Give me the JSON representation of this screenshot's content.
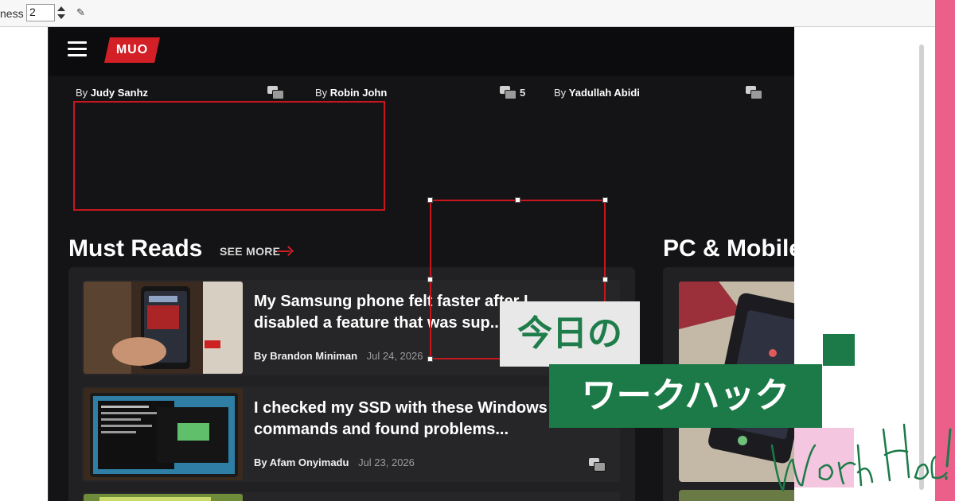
{
  "toolbar": {
    "thickness_label": "ness",
    "thickness_value": "2"
  },
  "site": {
    "logo_text": "MUO",
    "bylines": [
      {
        "prefix": "By",
        "author": "Judy Sanhz",
        "comments": ""
      },
      {
        "prefix": "By",
        "author": "Robin John",
        "comments": "5"
      },
      {
        "prefix": "By",
        "author": "Yadullah Abidi",
        "comments": ""
      }
    ],
    "must_reads": {
      "title": "Must Reads",
      "see_more": "SEE MORE"
    },
    "articles": [
      {
        "title_line1": "My Samsung phone felt faster after I",
        "title_line2": "disabled a feature that was sup...",
        "author": "By Brandon Miniman",
        "date": "Jul 24, 2026"
      },
      {
        "title_line1": "I checked my SSD with these Windows",
        "title_line2": "commands and found problems...",
        "author": "By Afam Onyimadu",
        "date": "Jul 23, 2026"
      }
    ],
    "pc_mobile": {
      "title": "PC & Mobile"
    }
  },
  "banner": {
    "line1": "今日の",
    "line2": "ワークハック",
    "signature": "Work Hack!"
  },
  "colors": {
    "accent_red": "#d31f26",
    "banner_green": "#1b7a47",
    "site_bg": "#141416",
    "pink": "#f4c6e0"
  }
}
